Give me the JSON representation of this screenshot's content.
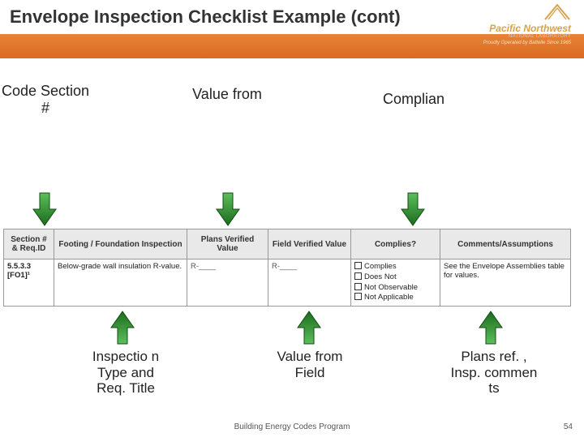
{
  "header": {
    "title": "Envelope Inspection Checklist Example (cont)",
    "brand_main": "Pacific Northwest",
    "brand_sub": "NATIONAL LABORATORY",
    "brand_tag": "Proudly Operated by Battelle Since 1965"
  },
  "callouts_top": {
    "code": "Code Section #",
    "value_plans": "Value from",
    "complian": "Complian"
  },
  "table": {
    "headers": {
      "section": "Section # & Req.ID",
      "inspection": "Footing / Foundation Inspection",
      "plans_verified": "Plans Verified Value",
      "field_verified": "Field Verified Value",
      "complies": "Complies?",
      "comments": "Comments/Assumptions"
    },
    "row": {
      "section": "5.5.3.3 [FO1]¹",
      "inspection": "Below-grade wall insulation R-value.",
      "plans_verified": "R-____",
      "field_verified": "R-____",
      "complies_options": [
        "Complies",
        "Does Not",
        "Not Observable",
        "Not Applicable"
      ],
      "comments": "See the Envelope Assemblies table for values."
    }
  },
  "callouts_bot": {
    "insp": "Inspectio\nn Type and Req. Title",
    "field": "Value from Field",
    "plans": "Plans ref. , Insp. commen\nts"
  },
  "footer": {
    "program": "Building Energy Codes Program",
    "page": "54"
  },
  "colors": {
    "arrow_fill": "#2a8a2a",
    "arrow_edge": "#0d4f10"
  }
}
